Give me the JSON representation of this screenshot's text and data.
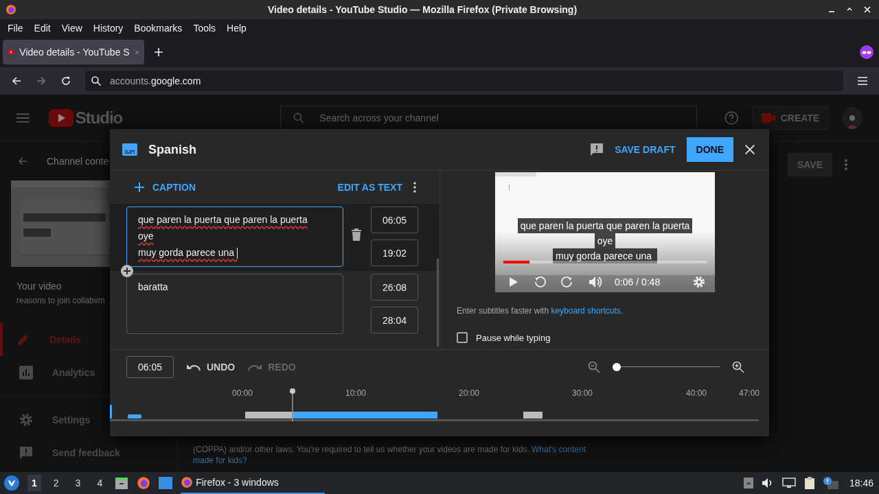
{
  "window": {
    "title": "Video details - YouTube Studio — Mozilla Firefox (Private Browsing)"
  },
  "menu": [
    "File",
    "Edit",
    "View",
    "History",
    "Bookmarks",
    "Tools",
    "Help"
  ],
  "tabs": [
    {
      "label": "Video details - YouTube S",
      "selected": true
    }
  ],
  "url": {
    "host_prefix": "accounts.",
    "host": "google.com"
  },
  "studio": {
    "logo_text": "Studio",
    "search_placeholder": "Search across your channel",
    "create": "CREATE",
    "back_label": "Channel conte",
    "your_video": "Your video",
    "video_title": "reasons to join collabvm",
    "nav": [
      {
        "label": "Details",
        "selected": true
      },
      {
        "label": "Analytics",
        "selected": false
      },
      {
        "label": "Settings",
        "selected": false
      },
      {
        "label": "Send feedback",
        "selected": false
      }
    ],
    "save": "SAVE",
    "notice": "(COPPA) and/or other laws. You're required to tell us whether your videos are made for kids.",
    "notice_link": "What's content",
    "notice_link2": "made for kids?"
  },
  "editor": {
    "language": "Spanish",
    "save_draft": "SAVE DRAFT",
    "done": "DONE",
    "add_caption": "CAPTION",
    "edit_as_text": "EDIT AS TEXT",
    "captions": [
      {
        "lines": [
          "que paren la puerta que paren la puerta",
          "oye",
          "muy gorda parece una "
        ],
        "start": "06:05",
        "end": "19:02",
        "selected": true
      },
      {
        "lines": [
          "baratta"
        ],
        "start": "26:08",
        "end": "28:04",
        "selected": false
      }
    ],
    "player": {
      "subtitles": [
        "que paren la puerta que paren la puerta",
        "oye",
        "muy gorda parece una "
      ],
      "level": 0.13,
      "time": "0:06 / 0:48"
    },
    "hint": "Enter subtitles faster with",
    "hint_link": "keyboard shortcuts.",
    "pause_label": "Pause while typing",
    "pause_checked": false,
    "current_time": "06:05",
    "undo": "UNDO",
    "redo": "REDO",
    "redo_disabled": true,
    "zoom": {
      "level": 0
    },
    "timeline_ticks": [
      "00:00",
      "10:00",
      "20:00",
      "30:00",
      "40:00",
      "47:00"
    ]
  },
  "taskbar": {
    "workspaces": [
      {
        "label": "1",
        "selected": true
      },
      {
        "label": "2",
        "selected": false
      },
      {
        "label": "3",
        "selected": false
      },
      {
        "label": "4",
        "selected": false
      }
    ],
    "task": "Firefox - 3 windows",
    "clock": "18:46"
  }
}
